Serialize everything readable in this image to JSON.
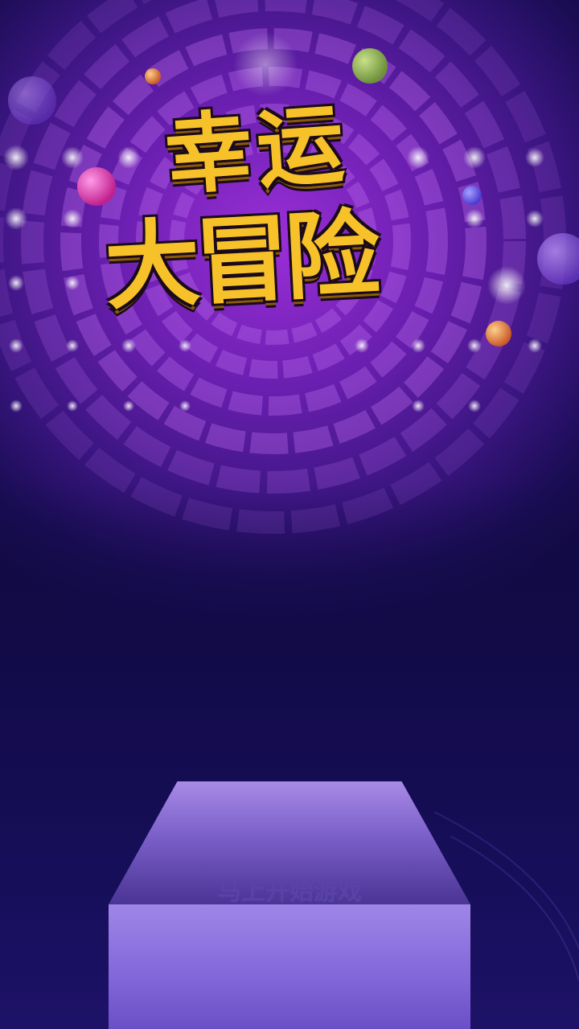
{
  "game": {
    "title_line1": "幸运",
    "title_line2": "大冒险",
    "start_button_label": "马上开始游戏"
  },
  "colors": {
    "title_fill": "#f7c12a",
    "background_top": "#9b2fd8",
    "background_bottom": "#120a40",
    "pedestal_top": "#a98ae6",
    "pedestal_front": "#8166d8"
  }
}
